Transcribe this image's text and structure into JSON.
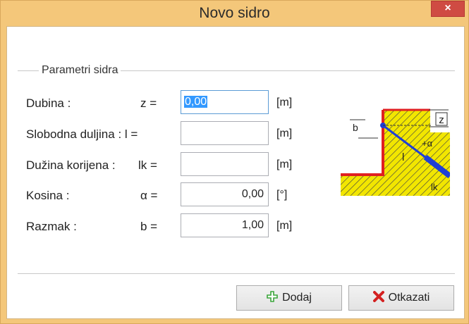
{
  "window": {
    "title": "Novo sidro",
    "close_symbol": "×"
  },
  "group": {
    "legend": "Parametri sidra"
  },
  "fields": [
    {
      "label": "Dubina :",
      "symbol": "z  =",
      "value": "0,00",
      "unit": "[m]",
      "focused": true
    },
    {
      "label": "Slobodna duljina : l  =",
      "symbol": "",
      "value": "",
      "unit": "[m]"
    },
    {
      "label": "Dužina korijena :",
      "symbol": "lk  =",
      "value": "",
      "unit": "[m]"
    },
    {
      "label": "Kosina :",
      "symbol": "α  =",
      "value": "0,00",
      "unit": "[°]"
    },
    {
      "label": "Razmak :",
      "symbol": "b  =",
      "value": "1,00",
      "unit": "[m]"
    }
  ],
  "buttons": {
    "add_label": "Dodaj",
    "cancel_label": "Otkazati"
  },
  "diagram": {
    "label_b": "b",
    "label_z": "z",
    "label_alpha": "+α",
    "label_l": "l",
    "label_lk": "lk"
  },
  "colors": {
    "title_bar": "#f4c77a",
    "close_button": "#cf4b43",
    "anchor_blue": "#1f3fd6",
    "soil_yellow": "#f2e600",
    "wall_red": "#e02020",
    "add_icon_green": "#3aa53a",
    "cancel_icon_red": "#d32020"
  }
}
